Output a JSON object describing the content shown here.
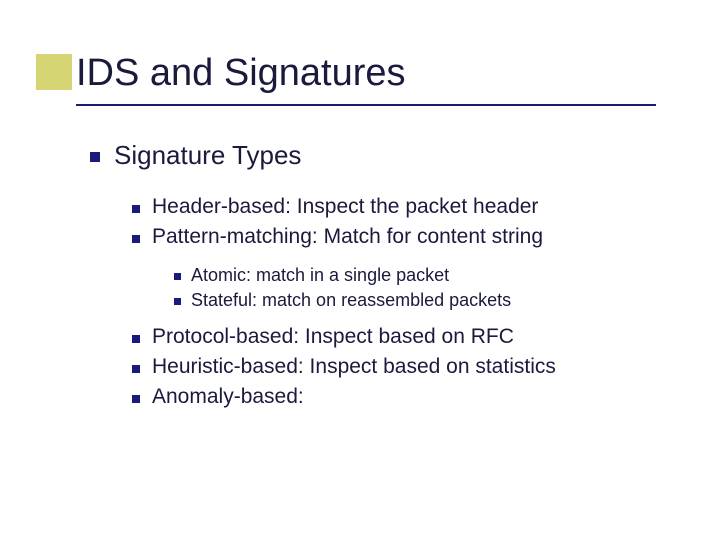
{
  "title": "IDS and Signatures",
  "lvl1": {
    "a": "Signature Types"
  },
  "lvl2": {
    "a": "Header-based: Inspect the packet header",
    "b": "Pattern-matching: Match for content string",
    "c": "Protocol-based: Inspect based on RFC",
    "d": "Heuristic-based: Inspect based on statistics",
    "e": "Anomaly-based:"
  },
  "lvl3": {
    "a": "Atomic: match in a single packet",
    "b": "Stateful: match on reassembled packets"
  }
}
